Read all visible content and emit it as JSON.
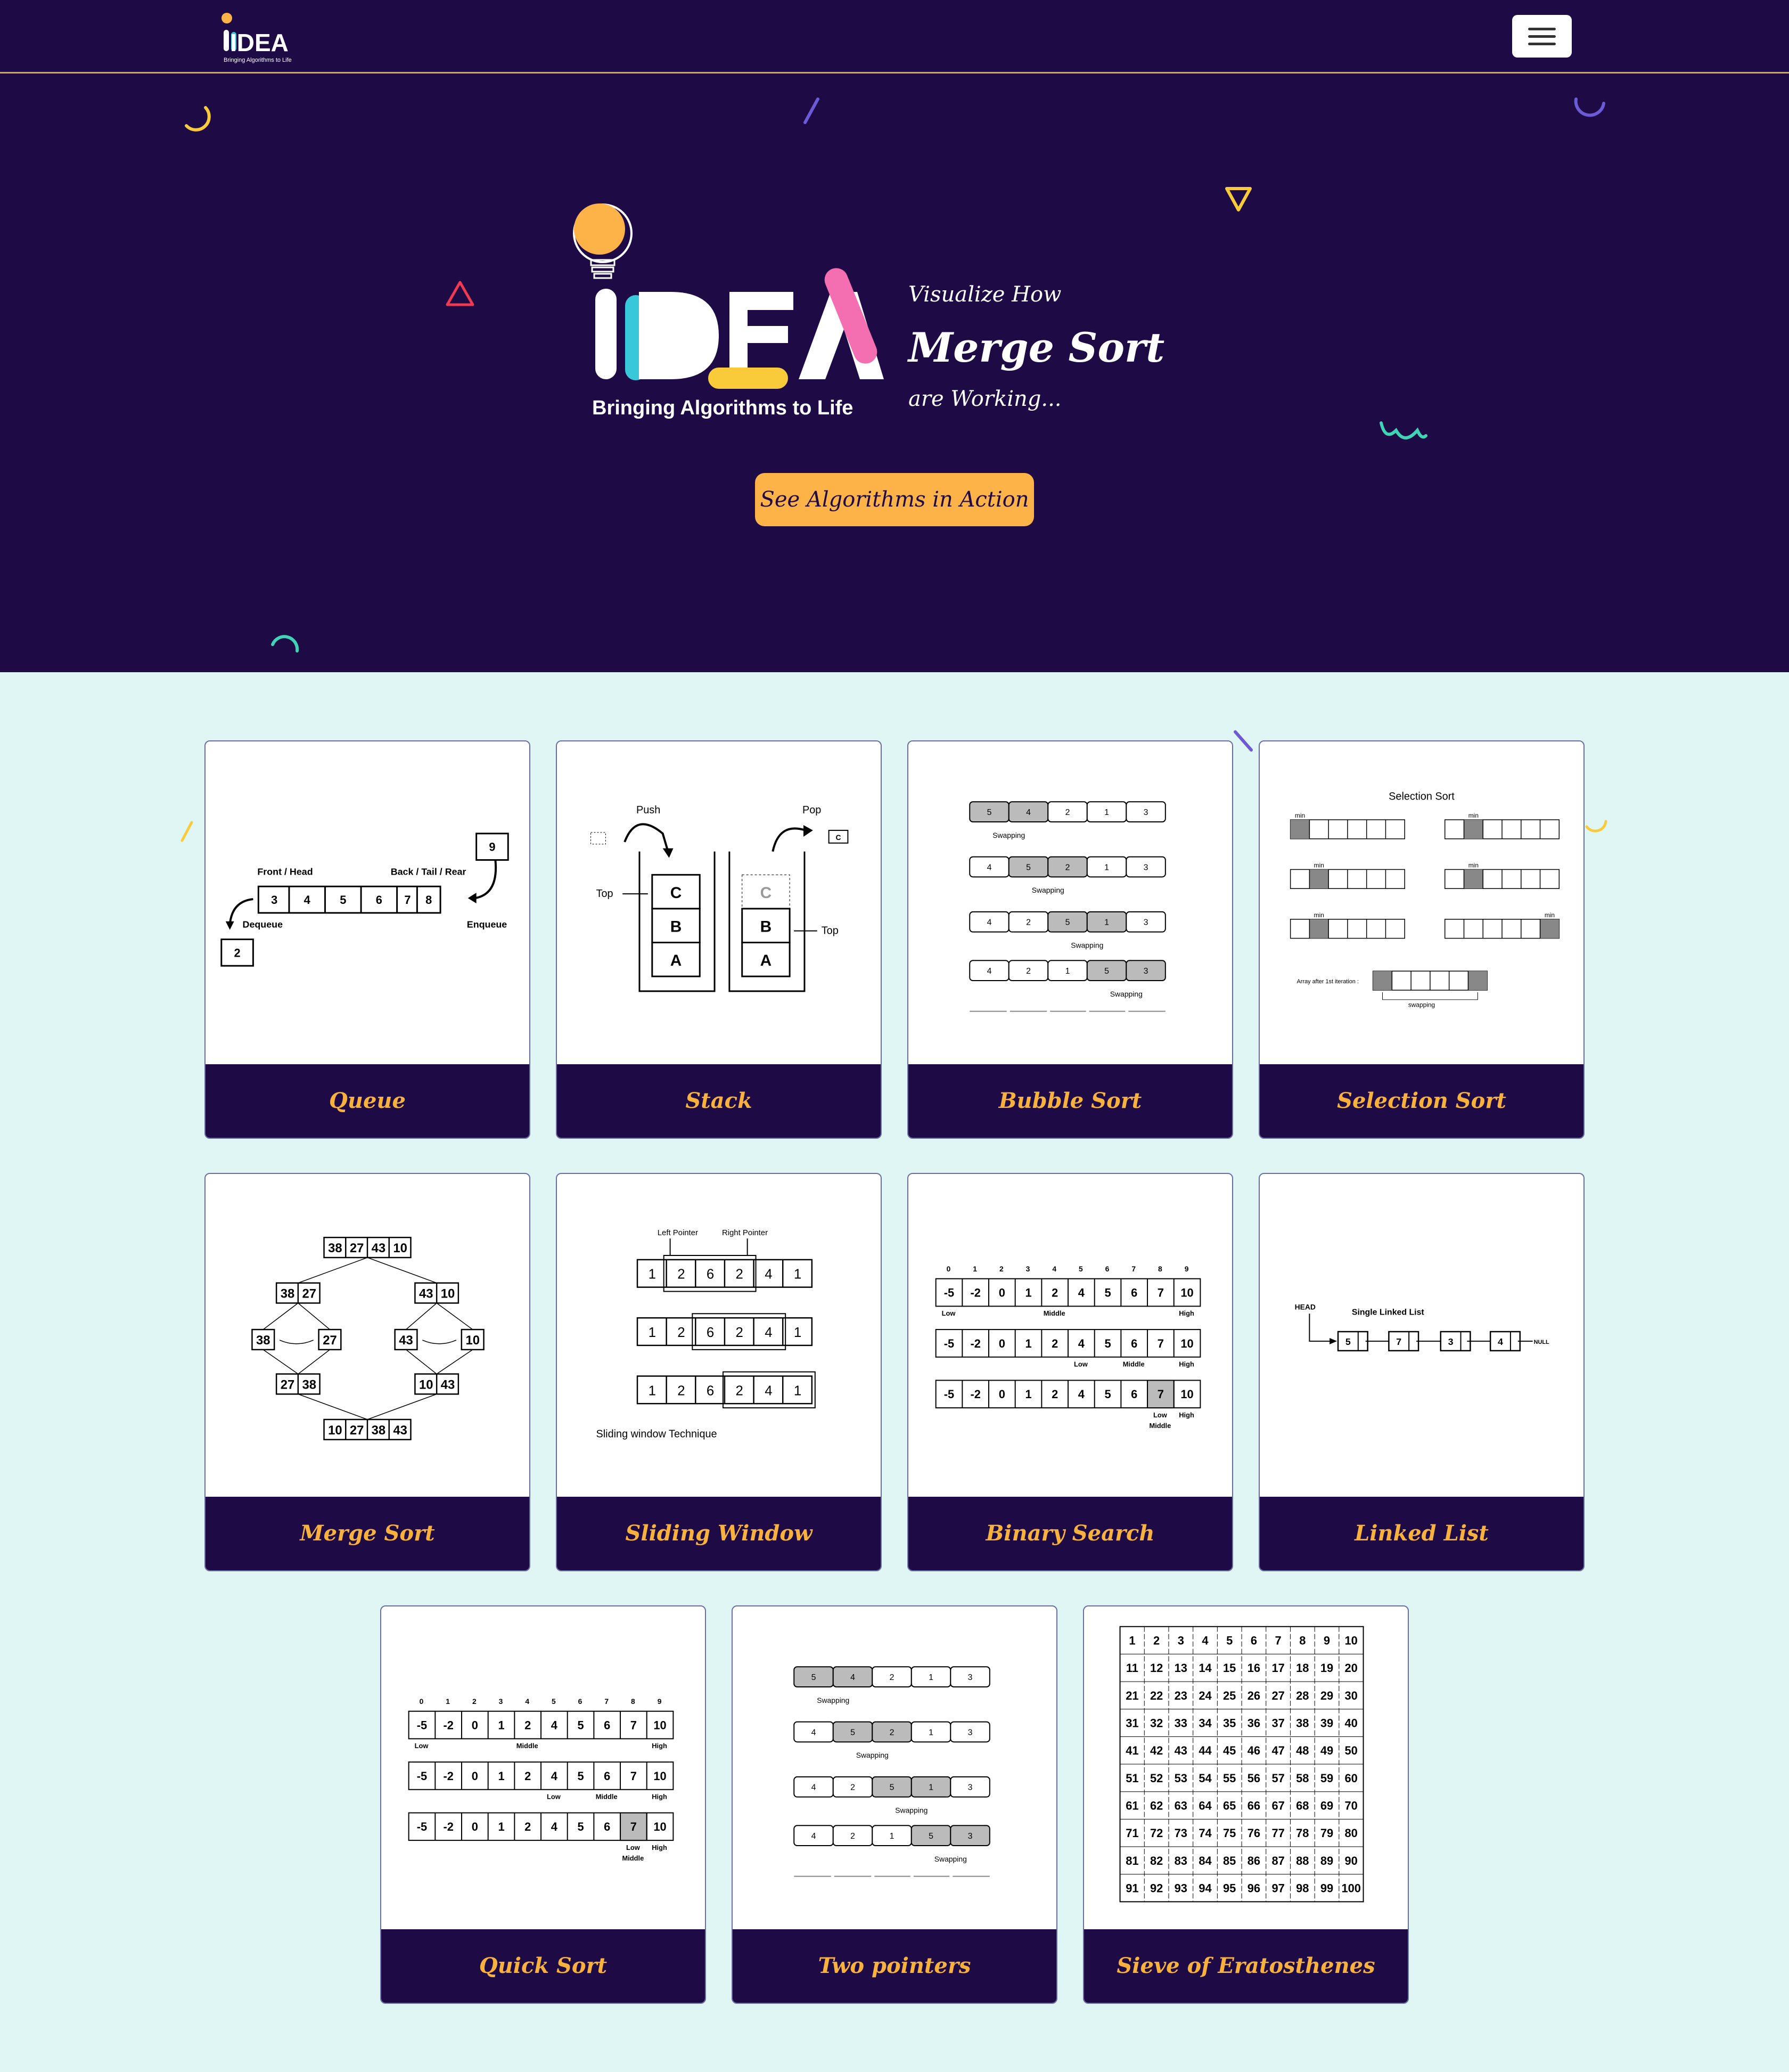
{
  "brand": {
    "logo_word": "IDEA",
    "logo_subtitle": "Bringing Algorithms to Life"
  },
  "hero": {
    "tagline_top": "Visualize How",
    "tagline_algorithm": "Merge Sort",
    "tagline_bottom": "are Working...",
    "cta_label": "See Algorithms in Action"
  },
  "colors": {
    "navy": "#1e0b46",
    "accent": "#fdb347",
    "background": "#e0f6f4",
    "pink": "#f36fb1",
    "cyan": "#39c8d9",
    "yellow": "#f9cb3a"
  },
  "cards": [
    {
      "title": "Queue"
    },
    {
      "title": "Stack"
    },
    {
      "title": "Bubble Sort"
    },
    {
      "title": "Selection Sort"
    },
    {
      "title": "Merge Sort"
    },
    {
      "title": "Sliding Window"
    },
    {
      "title": "Binary Search"
    },
    {
      "title": "Linked List"
    },
    {
      "title": "Quick Sort"
    },
    {
      "title": "Two pointers"
    },
    {
      "title": "Sieve of Eratosthenes"
    }
  ],
  "illustrations": {
    "queue": {
      "front_label": "Front / Head",
      "back_label": "Back / Tail / Rear",
      "values": [
        "3",
        "4",
        "5",
        "6",
        "7",
        "8"
      ],
      "incoming": "9",
      "outgoing": "2",
      "dequeue": "Dequeue",
      "enqueue": "Enqueue"
    },
    "stack": {
      "push": "Push",
      "pop": "Pop",
      "top": "Top",
      "left_stack": [
        "C",
        "B",
        "A"
      ],
      "right_stack": [
        "C",
        "B",
        "A"
      ],
      "small": "C"
    },
    "bubble": {
      "rows": [
        [
          "5",
          "4",
          "2",
          "1",
          "3"
        ],
        [
          "4",
          "5",
          "2",
          "1",
          "3"
        ],
        [
          "4",
          "2",
          "5",
          "1",
          "3"
        ],
        [
          "4",
          "2",
          "1",
          "5",
          "3"
        ]
      ],
      "swap": "Swapping"
    },
    "selection": {
      "title": "Selection Sort",
      "min": "min",
      "after": "Array after 1st iteration :",
      "swapping": "swapping"
    },
    "merge": {
      "top": [
        "38",
        "27",
        "43",
        "10"
      ],
      "l1": [
        "38",
        "27"
      ],
      "r1": [
        "43",
        "10"
      ],
      "l2a": "38",
      "l2b": "27",
      "r2a": "43",
      "r2b": "10",
      "l3": [
        "27",
        "38"
      ],
      "r3": [
        "10",
        "43"
      ],
      "bottom": [
        "10",
        "27",
        "38",
        "43"
      ]
    },
    "sliding": {
      "left_pointer": "Left Pointer",
      "right_pointer": "Right Pointer",
      "values": [
        "1",
        "2",
        "6",
        "2",
        "4",
        "1"
      ],
      "caption": "Sliding window Technique"
    },
    "binary": {
      "indices": [
        "0",
        "1",
        "2",
        "3",
        "4",
        "5",
        "6",
        "7",
        "8",
        "9"
      ],
      "values": [
        "-5",
        "-2",
        "0",
        "1",
        "2",
        "4",
        "5",
        "6",
        "7",
        "10"
      ],
      "low": "Low",
      "middle": "Middle",
      "high": "High"
    },
    "linked": {
      "head": "HEAD",
      "title": "Single Linked List",
      "values": [
        "5",
        "7",
        "3",
        "4"
      ],
      "null": "NULL"
    },
    "sieve": {
      "rows": 10,
      "cols": 10
    }
  }
}
